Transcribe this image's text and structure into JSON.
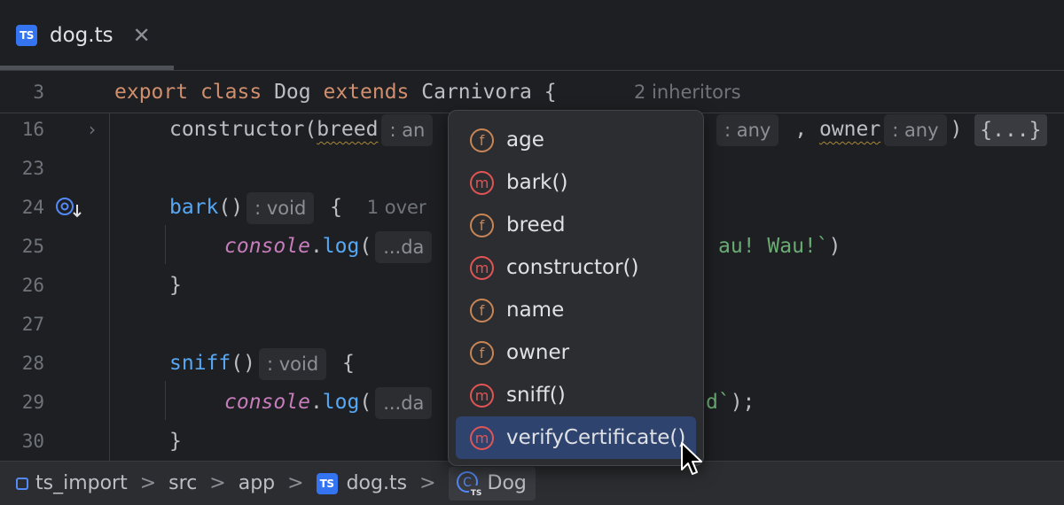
{
  "tab": {
    "badge": "TS",
    "name": "dog.ts",
    "close": "✕"
  },
  "sticky": {
    "line": "3",
    "kw1": "export",
    "kw2": "class",
    "name": "Dog",
    "kw3": "extends",
    "parent": "Carnivora",
    "brace": "{",
    "inheritors": "2 inheritors"
  },
  "lines": {
    "l16": {
      "num": "16",
      "fn": "constructor",
      "open": "(",
      "p1": "breed",
      "h1": ": an",
      "h2": ": any",
      "comma": ",",
      "p3": "owner",
      "h3": ": any",
      "close": ")",
      "fold": "{...}"
    },
    "l23": {
      "num": "23"
    },
    "l24": {
      "num": "24",
      "fn": "bark",
      "parens": "()",
      "hint": ": void",
      "brace": "{",
      "overrides": "1 over"
    },
    "l25": {
      "num": "25",
      "obj": "console",
      "dot": ".",
      "fn": "log",
      "open": "(",
      "hint": "...da",
      "str": "au! Wau!`",
      "close": ")"
    },
    "l26": {
      "num": "26",
      "brace": "}"
    },
    "l27": {
      "num": "27"
    },
    "l28": {
      "num": "28",
      "fn": "sniff",
      "parens": "()",
      "hint": ": void",
      "brace": "{"
    },
    "l29": {
      "num": "29",
      "obj": "console",
      "dot": ".",
      "fn": "log",
      "open": "(",
      "hint": "...da",
      "str": "d`",
      "close": ");"
    },
    "l30": {
      "num": "30",
      "brace": "}"
    }
  },
  "completion": {
    "items": [
      {
        "kind": "f",
        "label": "age"
      },
      {
        "kind": "m",
        "label": "bark()"
      },
      {
        "kind": "f",
        "label": "breed"
      },
      {
        "kind": "m",
        "label": "constructor()"
      },
      {
        "kind": "f",
        "label": "name"
      },
      {
        "kind": "f",
        "label": "owner"
      },
      {
        "kind": "m",
        "label": "sniff()"
      },
      {
        "kind": "m",
        "label": "verifyCertificate()"
      }
    ],
    "selected_index": 7
  },
  "breadcrumb": {
    "project": "ts_import",
    "src": "src",
    "app": "app",
    "file_badge": "TS",
    "file": "dog.ts",
    "class": "Dog",
    "sep": ">"
  },
  "colors": {
    "accent": "#3574f0",
    "selection": "#2e436e",
    "field": "#c88656",
    "method": "#e05555"
  }
}
